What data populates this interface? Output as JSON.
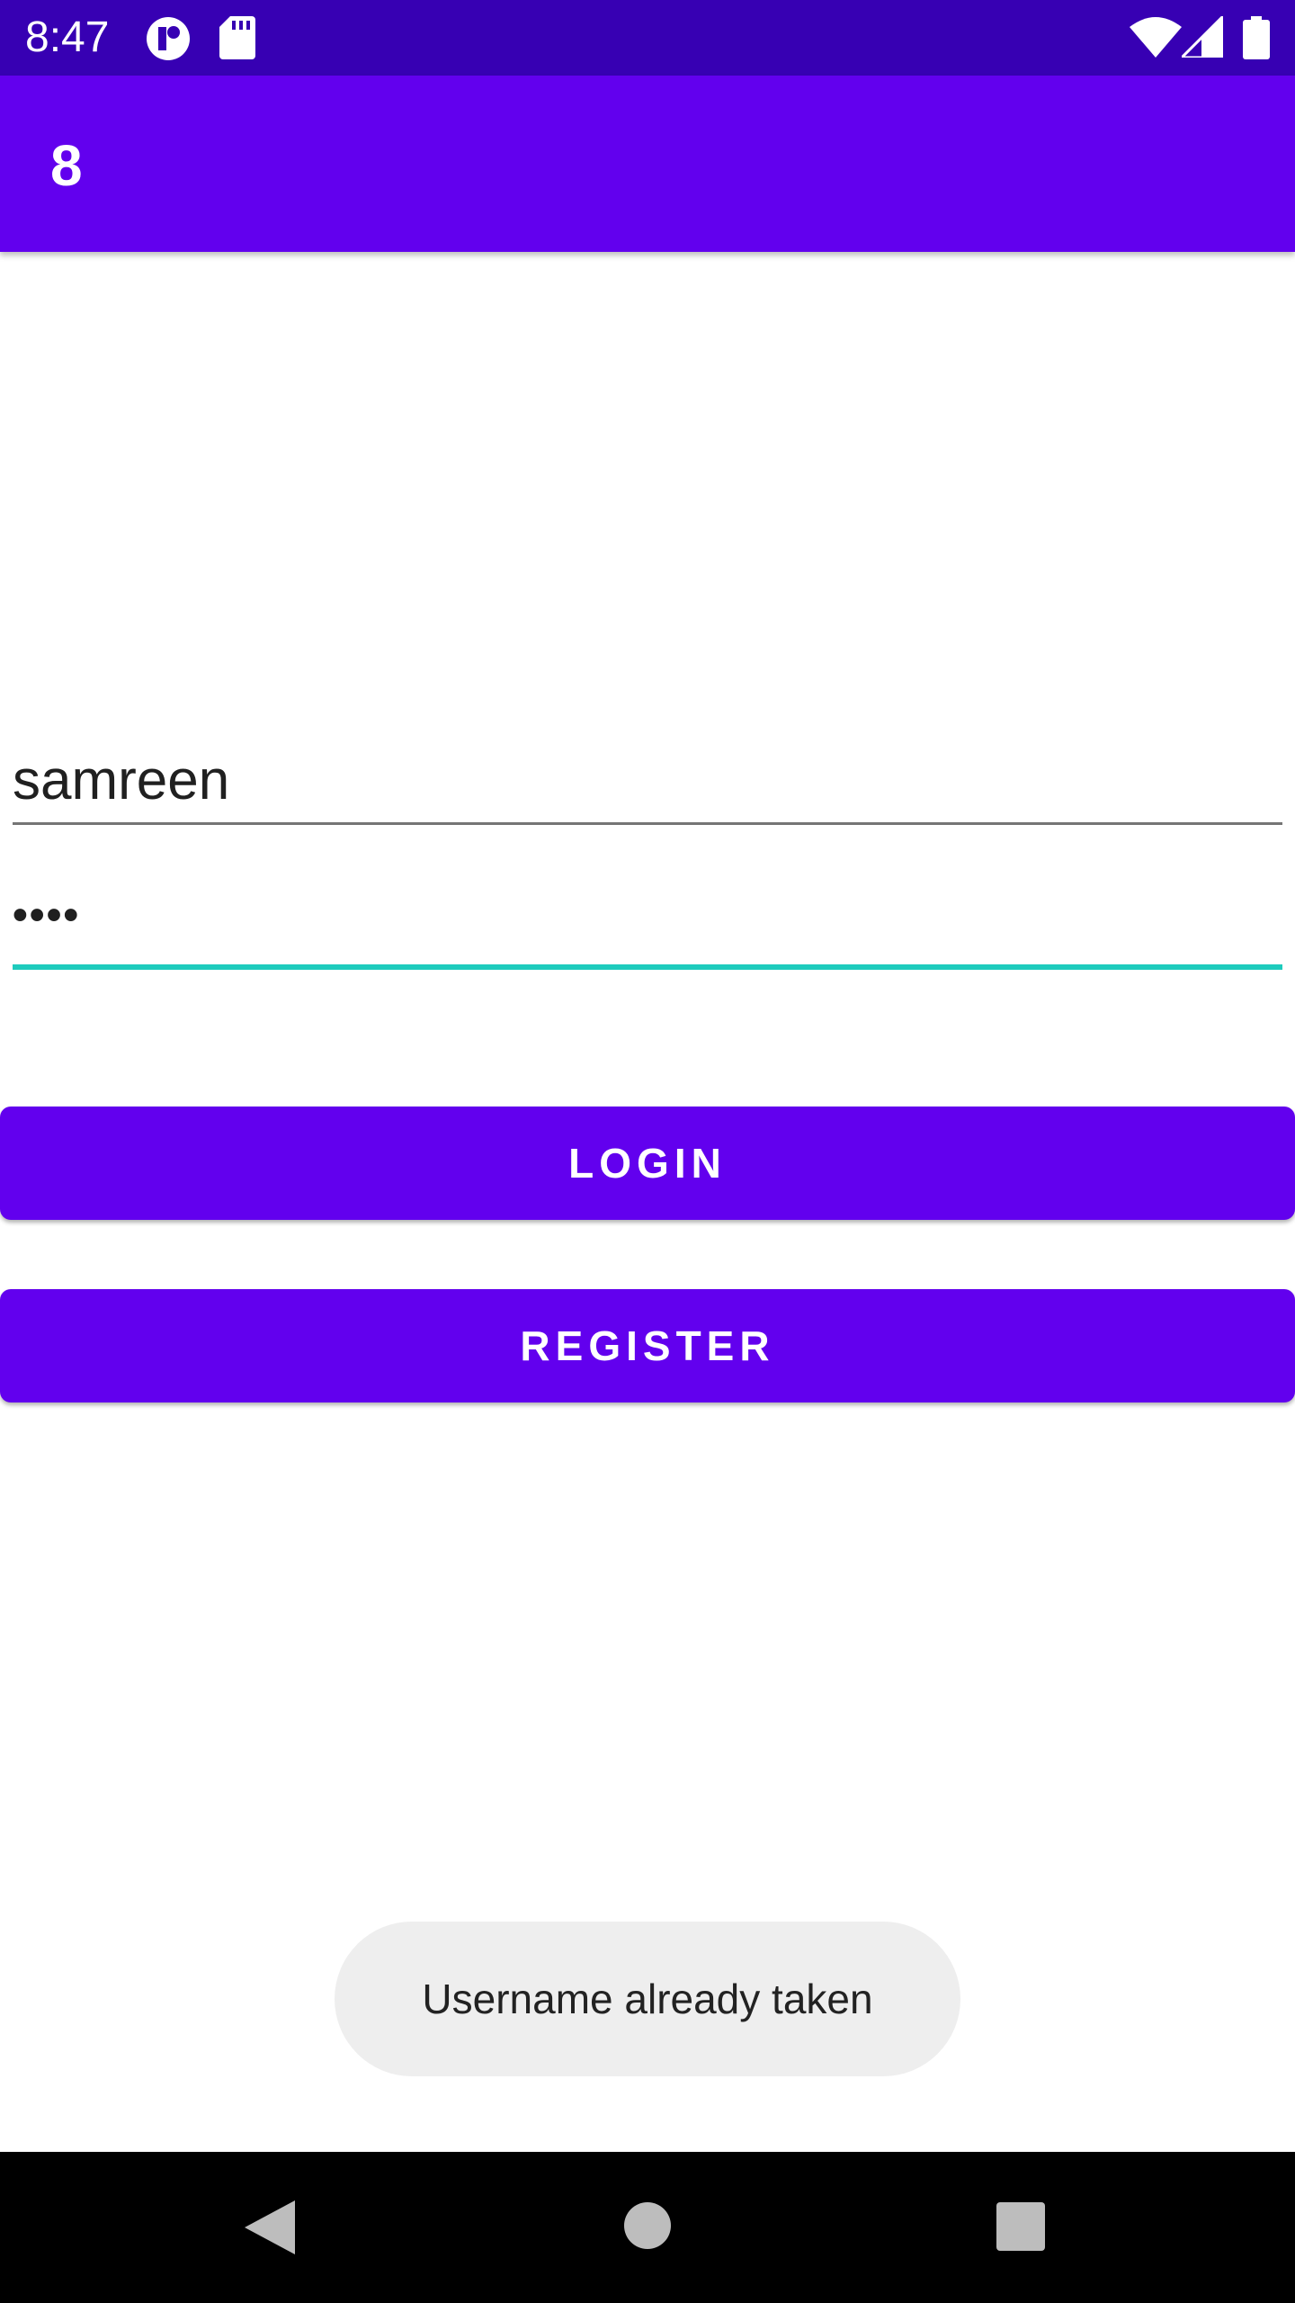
{
  "status_bar": {
    "time": "8:47",
    "left_icons": [
      "notification-app-icon",
      "sd-card-icon"
    ],
    "right_icons": [
      "wifi-icon",
      "cell-signal-icon",
      "battery-icon"
    ],
    "color": "#3700b3"
  },
  "app_bar": {
    "title": "8",
    "color": "#6200ee"
  },
  "form": {
    "username_value": "samreen",
    "password_value": "••••",
    "focus_color": "#1ecbbd"
  },
  "buttons": {
    "login_label": "LOGIN",
    "register_label": "REGISTER"
  },
  "toast": {
    "message": "Username already taken"
  },
  "nav_bar": {
    "icons": [
      "back-icon",
      "home-icon",
      "recents-icon"
    ]
  }
}
